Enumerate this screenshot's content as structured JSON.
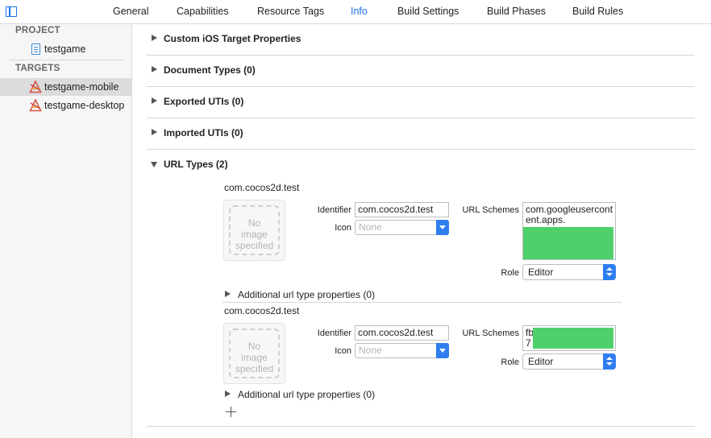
{
  "tabs": [
    "General",
    "Capabilities",
    "Resource Tags",
    "Info",
    "Build Settings",
    "Build Phases",
    "Build Rules"
  ],
  "active_tab": "Info",
  "sidebar": {
    "project_header": "PROJECT",
    "project_item": "testgame",
    "targets_header": "TARGETS",
    "targets": [
      "testgame-mobile",
      "testgame-desktop"
    ],
    "selected_target": "testgame-mobile"
  },
  "sections": {
    "custom_ios": "Custom iOS Target Properties",
    "document_types": "Document Types (0)",
    "exported_utis": "Exported UTIs (0)",
    "imported_utis": "Imported UTIs (0)",
    "url_types": "URL Types (2)"
  },
  "url_types": [
    {
      "name": "com.cocos2d.test",
      "image_placeholder": "No image specified",
      "image_line1": "No",
      "image_line2": "image",
      "image_line3": "specified",
      "identifier_label": "Identifier",
      "identifier": "com.cocos2d.test",
      "icon_label": "Icon",
      "icon_placeholder": "None",
      "schemes_label": "URL Schemes",
      "schemes_line1": "com.googleusercont",
      "schemes_line2": "ent.apps.",
      "role_label": "Role",
      "role": "Editor",
      "additional": "Additional url type properties (0)"
    },
    {
      "name": "com.cocos2d.test",
      "image_placeholder": "No image specified",
      "image_line1": "No",
      "image_line2": "image",
      "image_line3": "specified",
      "identifier_label": "Identifier",
      "identifier": "com.cocos2d.test",
      "icon_label": "Icon",
      "icon_placeholder": "None",
      "schemes_label": "URL Schemes",
      "schemes_line1": "fb",
      "schemes_line2": "7",
      "role_label": "Role",
      "role": "Editor",
      "additional": "Additional url type properties (0)"
    }
  ],
  "colors": {
    "accent": "#1a73e8",
    "redaction": "#4fd06a",
    "select_button": "#2f7ef0"
  },
  "icons": {
    "sidebar_toggle": "sidebar-toggle-icon",
    "project": "project-file-icon",
    "target": "app-target-icon",
    "add": "plus-icon"
  }
}
